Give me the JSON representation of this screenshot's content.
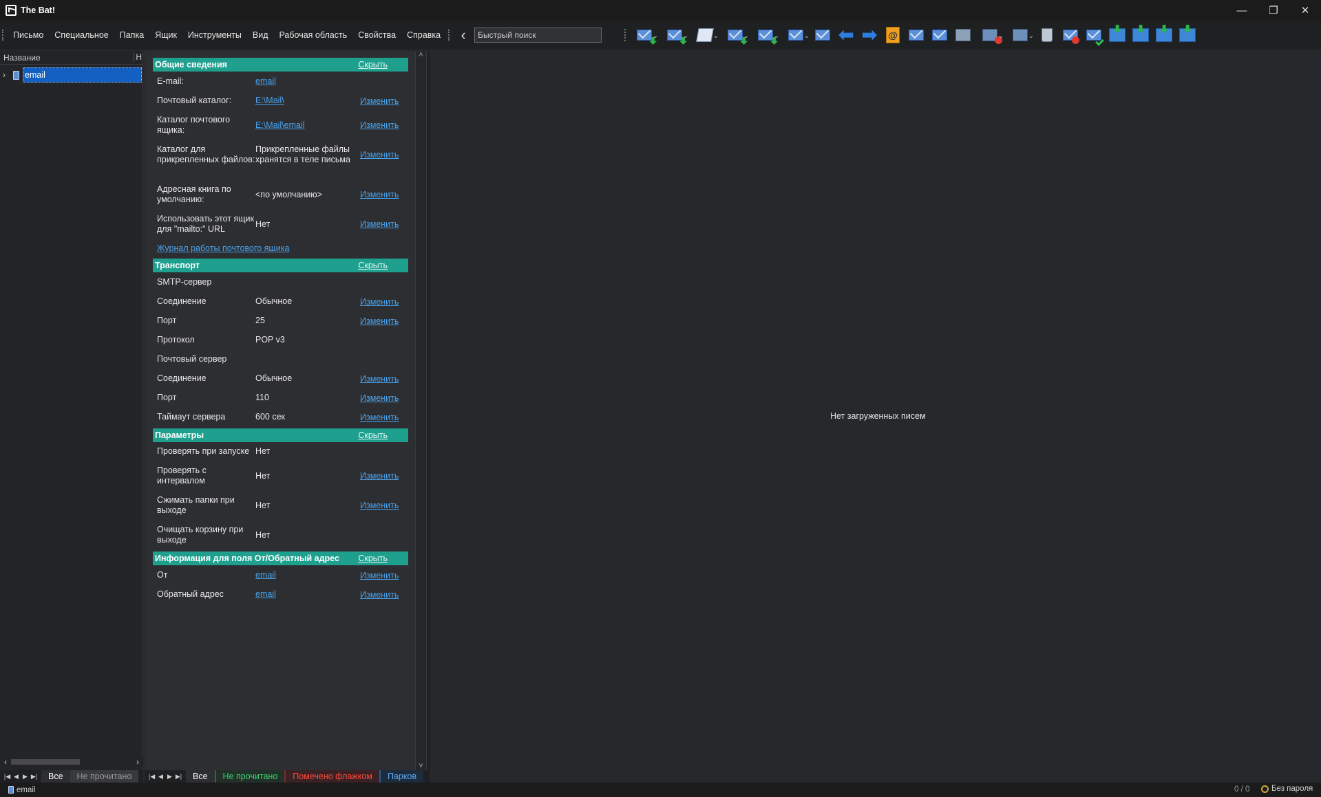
{
  "window": {
    "title": "The Bat!",
    "controls": [
      "—",
      "❐",
      "✕"
    ]
  },
  "menu": [
    "Письмо",
    "Специальное",
    "Папка",
    "Ящик",
    "Инструменты",
    "Вид",
    "Рабочая область",
    "Свойства",
    "Справка"
  ],
  "search": {
    "value": "Быстрый поиск"
  },
  "folder_panel": {
    "column_name": "Название",
    "column_second": "Н",
    "selected_folder": "email"
  },
  "sections": {
    "general": {
      "title": "Общие сведения",
      "hide": "Скрыть",
      "rows": [
        {
          "label": "E-mail:",
          "value": "email",
          "change": ""
        },
        {
          "label": "Почтовый каталог:",
          "value": "E:\\Mail\\",
          "change": "Изменить"
        },
        {
          "label": "Каталог почтового ящика:",
          "value": "E:\\Mail\\email",
          "change": "Изменить"
        },
        {
          "label": "Каталог для прикрепленных файлов:",
          "value": "Прикрепленные файлы хранятся в теле письма",
          "change": "Изменить"
        },
        {
          "label": "Адресная книга по умолчанию:",
          "value": "<по умолчанию>",
          "change": "Изменить"
        },
        {
          "label": "Использовать этот ящик для \"mailto:\" URL",
          "value": "Нет",
          "change": "Изменить"
        }
      ],
      "log_link": "Журнал работы почтового ящика"
    },
    "transport": {
      "title": "Транспорт",
      "hide": "Скрыть",
      "rows": [
        {
          "label": "SMTP-сервер",
          "value": "",
          "change": ""
        },
        {
          "label": "Соединение",
          "value": "Обычное",
          "change": "Изменить"
        },
        {
          "label": "Порт",
          "value": "25",
          "change": "Изменить"
        },
        {
          "label": "Протокол",
          "value": "POP v3",
          "change": ""
        },
        {
          "label": "Почтовый сервер",
          "value": "",
          "change": ""
        },
        {
          "label": "Соединение",
          "value": "Обычное",
          "change": "Изменить"
        },
        {
          "label": "Порт",
          "value": "110",
          "change": "Изменить"
        },
        {
          "label": "Таймаут сервера",
          "value": "600 сек",
          "change": "Изменить"
        }
      ]
    },
    "params": {
      "title": "Параметры",
      "hide": "Скрыть",
      "rows": [
        {
          "label": "Проверять при запуске",
          "value": "Нет",
          "change": ""
        },
        {
          "label": "Проверять с интервалом",
          "value": "Нет",
          "change": "Изменить"
        },
        {
          "label": "Сжимать папки при выходе",
          "value": "Нет",
          "change": "Изменить"
        },
        {
          "label": "Очищать корзину при выходе",
          "value": "Нет",
          "change": ""
        }
      ]
    },
    "from": {
      "title": "Информация для поля От/Обратный адрес",
      "hide": "Скрыть",
      "rows": [
        {
          "label": "От",
          "value": "email",
          "change": "Изменить"
        },
        {
          "label": "Обратный адрес",
          "value": "email",
          "change": "Изменить"
        }
      ]
    }
  },
  "message_area": {
    "empty_text": "Нет загруженных писем"
  },
  "folder_tabs": [
    "Все",
    "Не прочитано"
  ],
  "message_tabs": [
    "Все",
    "Не прочитано",
    "Помечено флажком",
    "Парков"
  ],
  "status": {
    "account": "email",
    "count": "0 / 0",
    "password": "Без пароля"
  },
  "colors": {
    "section_header": "#1fa08f",
    "link": "#4aa3ee",
    "selection": "#1360c2",
    "background": "#27282b"
  }
}
